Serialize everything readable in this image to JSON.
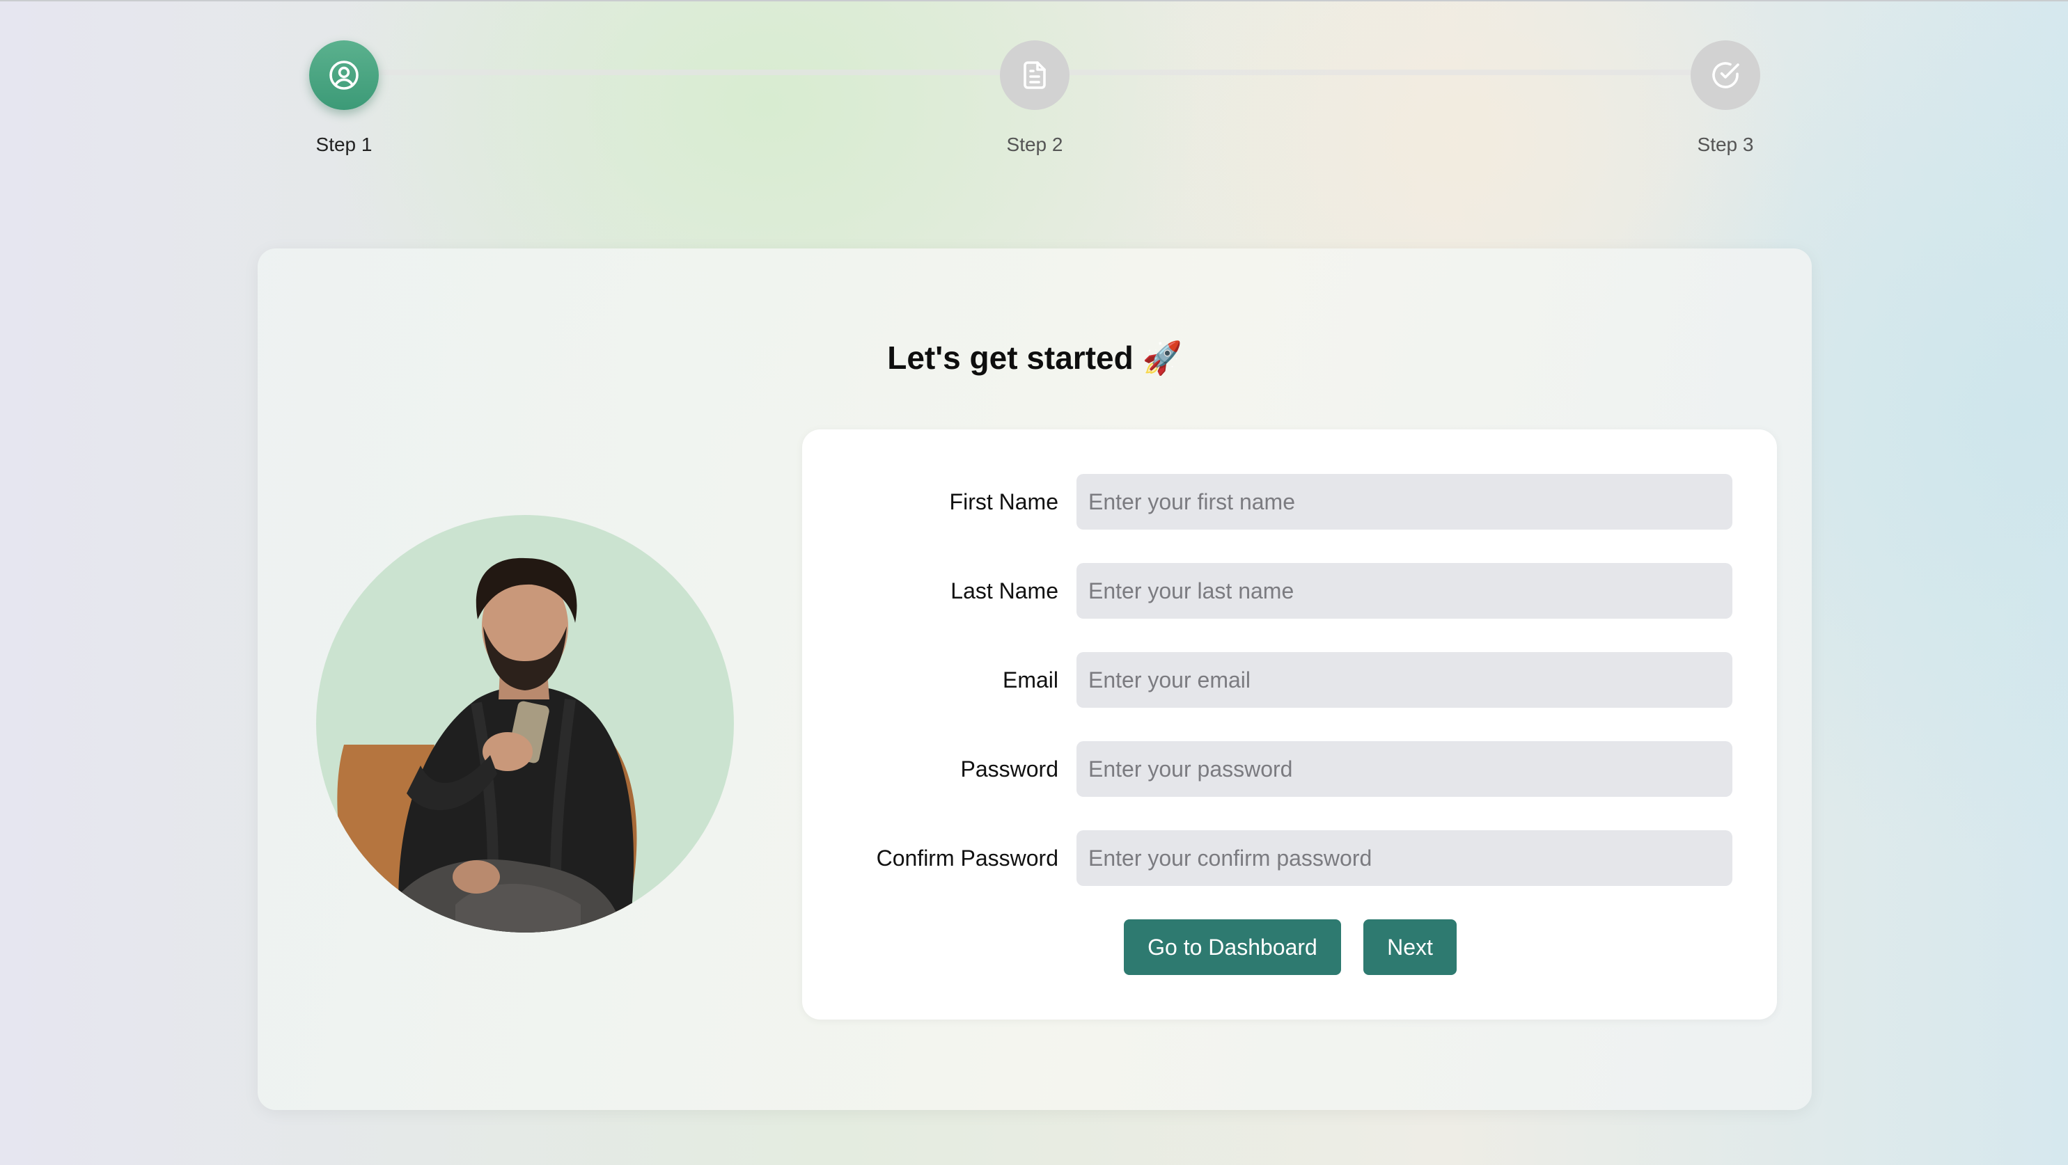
{
  "stepper": {
    "steps": [
      {
        "label": "Step 1",
        "icon": "user-circle-icon",
        "active": true
      },
      {
        "label": "Step 2",
        "icon": "document-icon",
        "active": false
      },
      {
        "label": "Step 3",
        "icon": "check-circle-icon",
        "active": false
      }
    ]
  },
  "card": {
    "title": "Let's get started 🚀"
  },
  "form": {
    "first_name": {
      "label": "First Name",
      "placeholder": "Enter your first name"
    },
    "last_name": {
      "label": "Last Name",
      "placeholder": "Enter your last name"
    },
    "email": {
      "label": "Email",
      "placeholder": "Enter your email"
    },
    "password": {
      "label": "Password",
      "placeholder": "Enter your password"
    },
    "confirm_password": {
      "label": "Confirm Password",
      "placeholder": "Enter your confirm password"
    },
    "dashboard_button": "Go to Dashboard",
    "next_button": "Next"
  },
  "colors": {
    "accent": "#2e7a70",
    "step_active": "#4aa582",
    "step_inactive": "#d2d2d2",
    "avatar_bg": "#cbe3d0",
    "input_bg": "#e5e6ea"
  }
}
